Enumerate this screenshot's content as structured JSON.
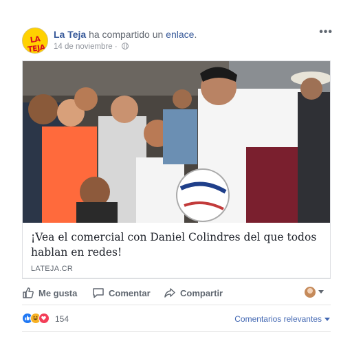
{
  "post": {
    "page_name": "La Teja",
    "action_text": "ha compartido un",
    "link_word": "enlace",
    "period": ".",
    "timestamp": "14 de noviembre",
    "separator": "·",
    "avatar_logo": "LA TEJA",
    "more_label": "•••"
  },
  "card": {
    "title": "¡Vea el comercial con Daniel Colindres del que todos hablan en redes!",
    "domain": "LATEJA.CR"
  },
  "actions": {
    "like_label": "Me gusta",
    "comment_label": "Comentar",
    "share_label": "Compartir"
  },
  "reactions": {
    "count": "154",
    "types": [
      "like",
      "haha",
      "love"
    ],
    "sort_label": "Comentarios relevantes"
  },
  "colors": {
    "link_blue": "#365899",
    "like_blue": "#2078f4",
    "haha_yellow": "#f7b125",
    "love_red": "#f33e58"
  }
}
